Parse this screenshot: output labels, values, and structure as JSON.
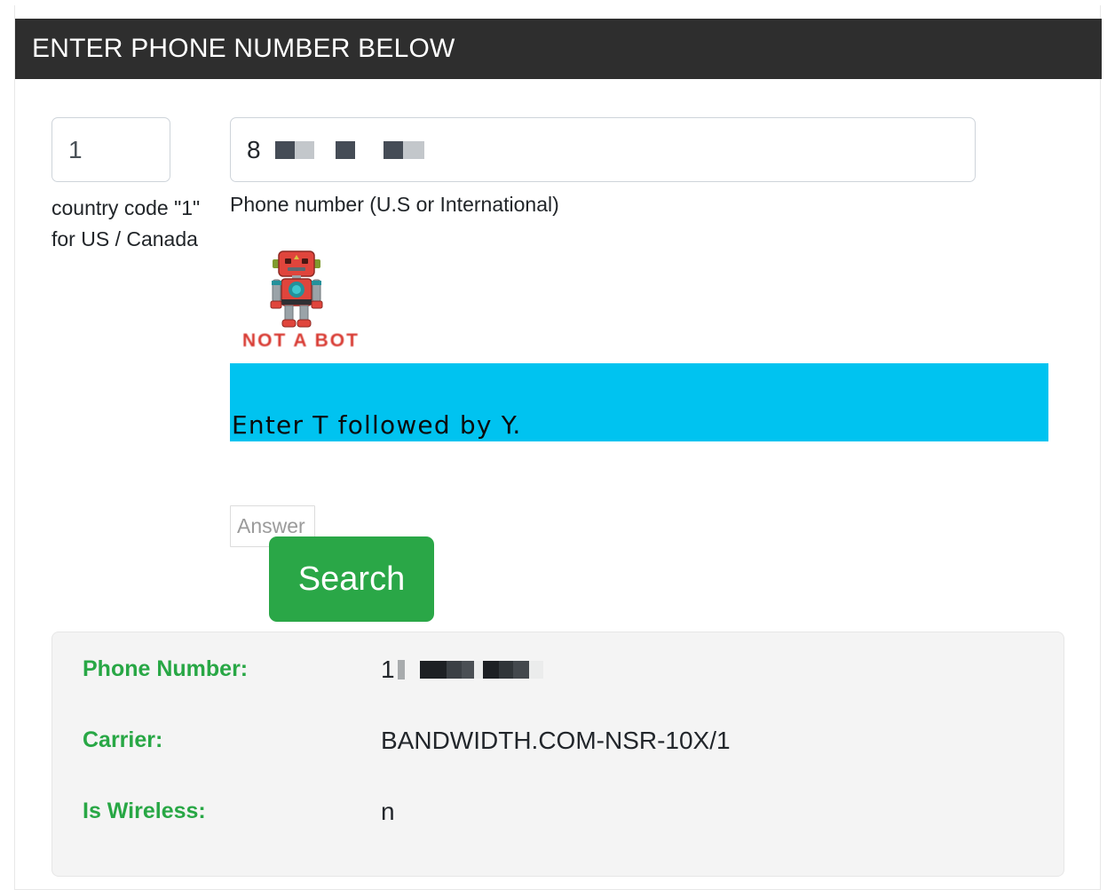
{
  "header": {
    "title": "ENTER PHONE NUMBER BELOW"
  },
  "form": {
    "country_code_value": "1",
    "country_code_placeholder": "1",
    "country_code_label": "country code \"1\" for US / Canada",
    "phone_label": "Phone number (U.S or International)",
    "phone_visible_prefix": "8",
    "phone_redacted": true
  },
  "captcha": {
    "robot_icon": "robot-icon",
    "not_a_bot_text": "NOT A BOT",
    "challenge_text": "Enter T followed by Y.",
    "banner_color": "#00c3f0",
    "answer_value": "",
    "answer_placeholder": "Answer"
  },
  "actions": {
    "search_label": "Search",
    "search_color": "#2aa747"
  },
  "results": {
    "label_color": "#28a745",
    "rows": [
      {
        "label": "Phone Number:",
        "value": "1",
        "redacted": true
      },
      {
        "label": "Carrier:",
        "value": "BANDWIDTH.COM-NSR-10X/1",
        "redacted": false
      },
      {
        "label": "Is Wireless:",
        "value": "n",
        "redacted": false
      }
    ]
  }
}
